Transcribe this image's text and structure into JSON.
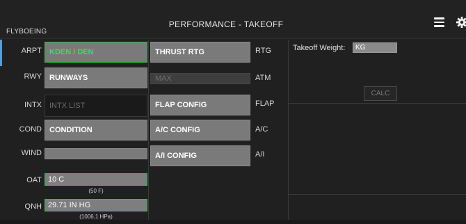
{
  "header": {
    "brand": "FLYBOEING",
    "title": "PERFORMANCE - TAKEOFF"
  },
  "left": {
    "arpt": {
      "label": "ARPT",
      "value": "KDEN / DEN"
    },
    "rwy": {
      "label": "RWY",
      "value": "RUNWAYS"
    },
    "intx": {
      "label": "INTX",
      "placeholder": "INTX LIST"
    },
    "cond": {
      "label": "COND",
      "value": "CONDITION"
    },
    "wind": {
      "label": "WIND",
      "value": ""
    },
    "oat": {
      "label": "OAT",
      "value": "10 C",
      "sub": "(50 F)"
    },
    "qnh": {
      "label": "QNH",
      "value": "29.71 IN HG",
      "sub": "(1006.1 HPa)"
    }
  },
  "middle": {
    "thrust": {
      "button": "THRUST RTG",
      "label": "RTG"
    },
    "atm": {
      "value": "MAX",
      "label": "ATM"
    },
    "flap": {
      "button": "FLAP CONFIG",
      "label": "FLAP"
    },
    "ac": {
      "button": "A/C CONFIG",
      "label": "A/C"
    },
    "ai": {
      "button": "A/I CONFIG",
      "label": "A/I"
    }
  },
  "right": {
    "takeoff_weight_label": "Takeoff Weight:",
    "takeoff_weight_unit": "KG",
    "calc_label": "CALC"
  },
  "colors": {
    "accent_green": "#3dde5a",
    "field_gray": "#7a7a7a",
    "background": "#202020",
    "side_accent": "#5b9bd5"
  }
}
